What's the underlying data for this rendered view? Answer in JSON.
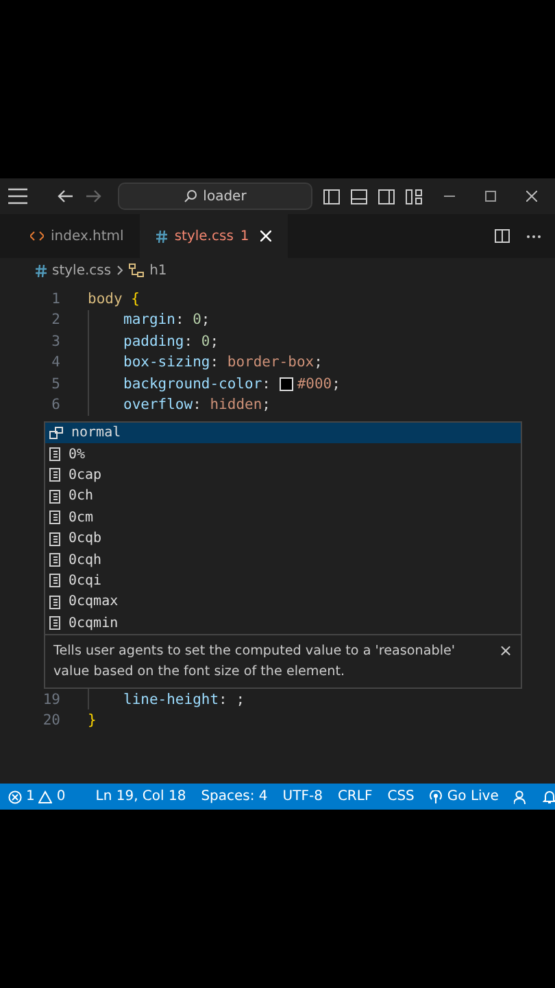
{
  "title_bar": {
    "search": "loader"
  },
  "tabs": [
    {
      "label": "index.html",
      "kind": "html",
      "selected": false,
      "problems": false
    },
    {
      "label": "style.css",
      "kind": "css",
      "selected": true,
      "problems": true,
      "badge": "1"
    }
  ],
  "breadcrumb": {
    "file": "style.css",
    "symbol": "h1"
  },
  "code_top": [
    {
      "number": "1",
      "indented": false,
      "tokens": [
        {
          "kind": "selector",
          "text": "body"
        },
        {
          "kind": "brace",
          "text": " {"
        }
      ]
    },
    {
      "number": "2",
      "indented": true,
      "tokens": [
        {
          "kind": "property",
          "text": "margin"
        },
        {
          "kind": "punct",
          "text": ": "
        },
        {
          "kind": "number",
          "text": "0"
        },
        {
          "kind": "punct",
          "text": ";"
        }
      ]
    },
    {
      "number": "3",
      "indented": true,
      "tokens": [
        {
          "kind": "property",
          "text": "padding"
        },
        {
          "kind": "punct",
          "text": ": "
        },
        {
          "kind": "number",
          "text": "0"
        },
        {
          "kind": "punct",
          "text": ";"
        }
      ]
    },
    {
      "number": "4",
      "indented": true,
      "tokens": [
        {
          "kind": "property",
          "text": "box-sizing"
        },
        {
          "kind": "punct",
          "text": ": "
        },
        {
          "kind": "value",
          "text": "border-box"
        },
        {
          "kind": "punct",
          "text": ";"
        }
      ]
    },
    {
      "number": "5",
      "indented": true,
      "tokens": [
        {
          "kind": "property",
          "text": "background-color"
        },
        {
          "kind": "punct",
          "text": ": "
        },
        {
          "kind": "swatch"
        },
        {
          "kind": "value",
          "text": "#000"
        },
        {
          "kind": "punct",
          "text": ";"
        }
      ]
    },
    {
      "number": "6",
      "indented": true,
      "tokens": [
        {
          "kind": "property",
          "text": "overflow"
        },
        {
          "kind": "punct",
          "text": ": "
        },
        {
          "kind": "value",
          "text": "hidden"
        },
        {
          "kind": "punct",
          "text": ";"
        }
      ]
    }
  ],
  "suggestions": [
    {
      "label": "normal",
      "kind": "keyword",
      "selected": true
    },
    {
      "label": "0%",
      "kind": "unit",
      "selected": false
    },
    {
      "label": "0cap",
      "kind": "unit",
      "selected": false
    },
    {
      "label": "0ch",
      "kind": "unit",
      "selected": false
    },
    {
      "label": "0cm",
      "kind": "unit",
      "selected": false
    },
    {
      "label": "0cqb",
      "kind": "unit",
      "selected": false
    },
    {
      "label": "0cqh",
      "kind": "unit",
      "selected": false
    },
    {
      "label": "0cqi",
      "kind": "unit",
      "selected": false
    },
    {
      "label": "0cqmax",
      "kind": "unit",
      "selected": false
    },
    {
      "label": "0cqmin",
      "kind": "unit",
      "selected": false
    }
  ],
  "details": {
    "text": "Tells user agents to set the computed value to a 'reasonable' value based on the font size of the element.",
    "close": "×"
  },
  "code_bottom": [
    {
      "number": "19",
      "indented": true,
      "tokens": [
        {
          "kind": "property",
          "text": "line-height"
        },
        {
          "kind": "punct",
          "text": ": "
        },
        {
          "kind": "punct",
          "text": ";"
        }
      ]
    },
    {
      "number": "20",
      "indented": false,
      "tokens": [
        {
          "kind": "brace",
          "text": "}"
        }
      ]
    }
  ],
  "status_bar": {
    "errors": "1",
    "warnings": "0",
    "items": [
      "Ln 19, Col 18",
      "Spaces: 4",
      "UTF-8",
      "CRLF",
      "CSS"
    ],
    "go_live": "Go Live"
  }
}
